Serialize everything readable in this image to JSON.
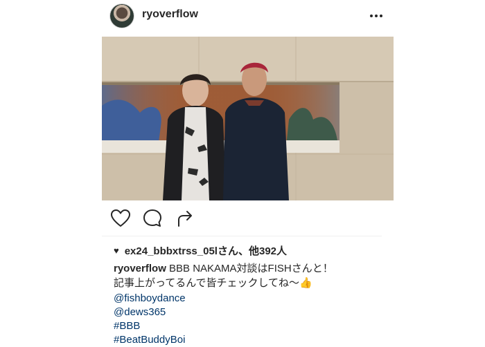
{
  "post": {
    "username": "ryoverflow",
    "more_icon": "more-icon",
    "avatar": "avatar"
  },
  "actions": {
    "like_icon": "heart-outline-icon",
    "comment_icon": "comment-icon",
    "share_icon": "share-icon"
  },
  "likes": {
    "icon": "heart-filled-icon",
    "text": "ex24_bbbxtrss_05lさん、他392人"
  },
  "caption": {
    "username": "ryoverflow",
    "line1": " BBB NAKAMA対談はFISHさんと！",
    "line2": "記事上がってるんで皆チェックしてね〜👍"
  },
  "tags": [
    "@fishboydance",
    "@dews365",
    "#BBB",
    "#BeatBuddyBoi"
  ],
  "colors": {
    "text": "#262626",
    "link": "#003569",
    "divider": "#efefef"
  }
}
